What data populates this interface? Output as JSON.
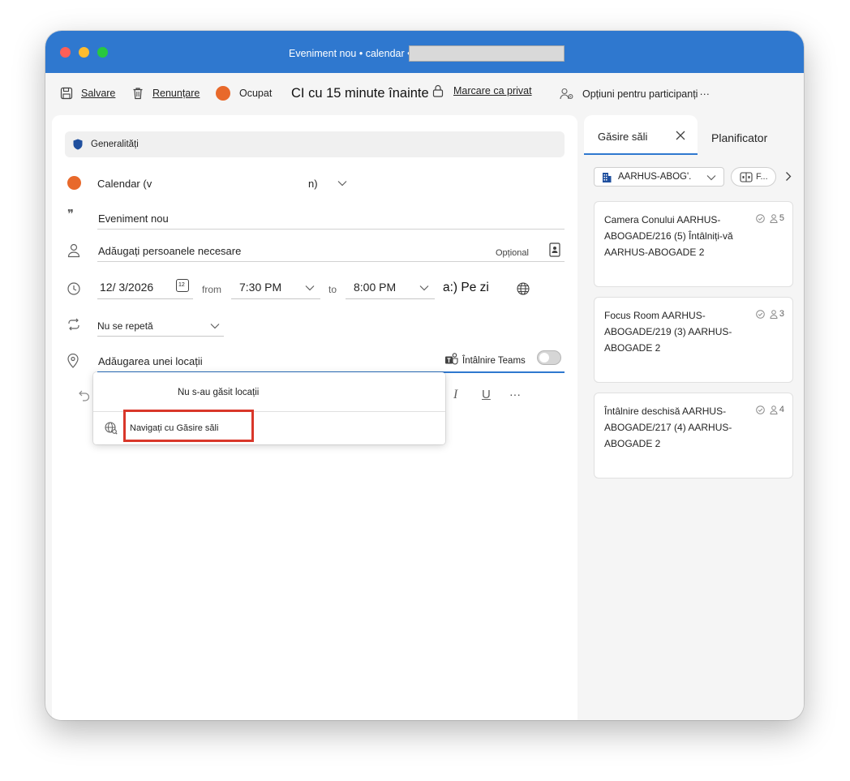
{
  "window": {
    "title": "Eveniment nou • calendar •",
    "brand_color": "#2f78cf",
    "traffic_lights": [
      "#ff5f57",
      "#febc2e",
      "#28c840"
    ]
  },
  "toolbar": {
    "save_label": "Salvare",
    "discard_label": "Renunțare",
    "status_label": "Ocupat",
    "status_color": "#e8692b",
    "reminder_label": "CI cu 15 minute înainte",
    "private_label": "Marcare ca privat",
    "attendee_options_label": "Opțiuni pentru participanți",
    "more_label": "···"
  },
  "event": {
    "section_label": "Generalități",
    "calendar_label": "Calendar (v",
    "calendar_suffix": "n)",
    "calendar_color": "#e8692b",
    "title_value": "Eveniment nou",
    "people_placeholder": "Adăugați persoanele necesare",
    "optional_label": "Opțional",
    "start_date": "12/ 3/2026",
    "calendar_day": "12",
    "from_label": "from",
    "start_time": "7:30 PM",
    "to_label": "to",
    "end_time": "8:00 PM",
    "all_day_label": "a:) Pe zi",
    "repeat_value": "Nu se repetă",
    "location_placeholder": "Adăugarea unei locații",
    "teams_label": "Întâlnire Teams"
  },
  "location_dropdown": {
    "no_results": "Nu s-au găsit locații",
    "browse_label": "Navigați cu Găsire săli"
  },
  "format_toolbar": {
    "italic": "I",
    "underline": "U",
    "more": "···"
  },
  "room_finder": {
    "tab_label": "Găsire săli",
    "scheduler_tab_label": "Planificator",
    "building_filter": "AARHUS-ABOG'.",
    "features_filter": "F...",
    "rooms": [
      {
        "name": "Camera Conului AARHUS-ABOGADE/216 (5) Întâlniți-vă AARHUS-ABOGADE 2",
        "capacity": "5"
      },
      {
        "name": "Focus Room AARHUS-ABOGADE/219 (3) AARHUS-ABOGADE 2",
        "capacity": "3"
      },
      {
        "name": "Întâlnire deschisă AARHUS-ABOGADE/217 (4) AARHUS-ABOGADE 2",
        "capacity": "4"
      }
    ]
  }
}
